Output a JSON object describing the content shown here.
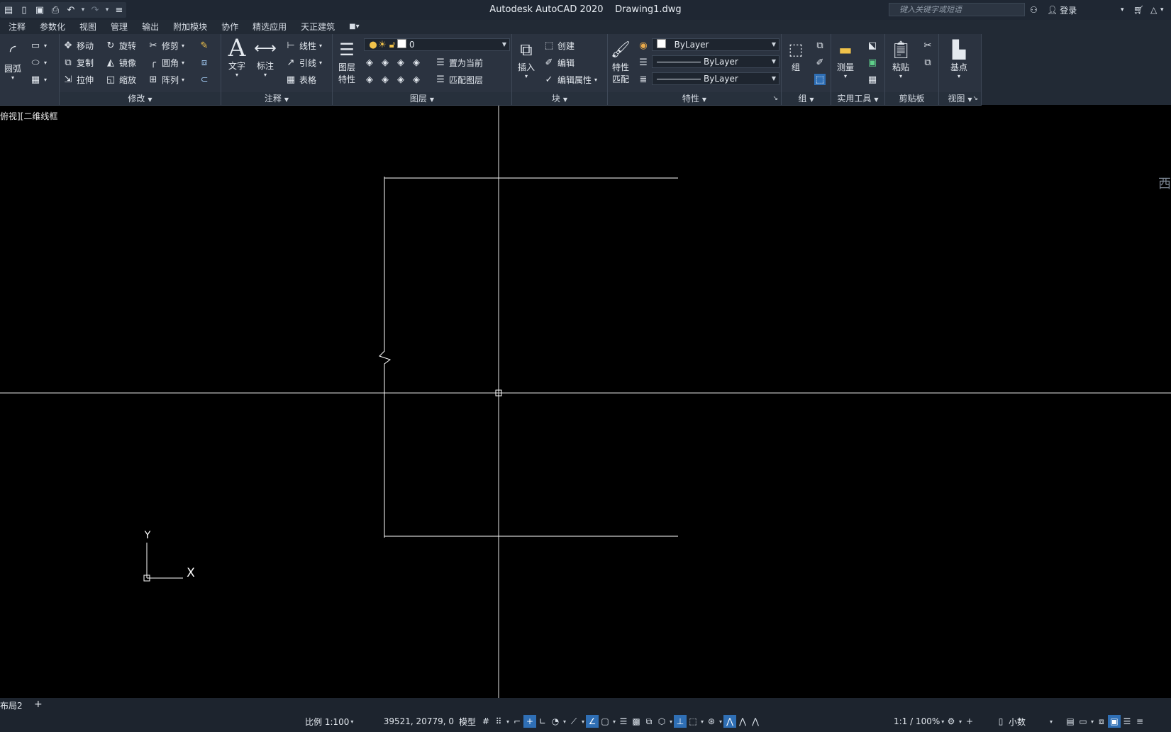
{
  "titlebar": {
    "app_title": "Autodesk AutoCAD 2020",
    "file_name": "Drawing1.dwg",
    "search_placeholder": "键入关键字或短语",
    "signin_label": "登录"
  },
  "menu": [
    "注释",
    "参数化",
    "视图",
    "管理",
    "输出",
    "附加模块",
    "协作",
    "精选应用",
    "天正建筑"
  ],
  "ribbon": {
    "draw": {
      "arc_label": "圆弧"
    },
    "modify": {
      "panel_label": "修改",
      "move": "移动",
      "rotate": "旋转",
      "trim": "修剪",
      "copy": "复制",
      "mirror": "镜像",
      "fillet": "圆角",
      "stretch": "拉伸",
      "scale": "缩放",
      "array": "阵列"
    },
    "annotation": {
      "panel_label": "注释",
      "text": "文字",
      "dimension": "标注",
      "linear": "线性",
      "leader": "引线",
      "table": "表格"
    },
    "layers": {
      "panel_label": "图层",
      "layer_props_1": "图层",
      "layer_props_2": "特性",
      "current_layer": "0",
      "set_current": "置为当前",
      "match_layer": "匹配图层"
    },
    "block": {
      "panel_label": "块",
      "insert": "插入",
      "create": "创建",
      "edit": "编辑",
      "edit_attr": "编辑属性"
    },
    "properties": {
      "panel_label": "特性",
      "match_1": "特性",
      "match_2": "匹配",
      "color": "ByLayer",
      "linetype": "ByLayer",
      "lineweight": "ByLayer"
    },
    "groups": {
      "panel_label": "组",
      "group": "组"
    },
    "utilities": {
      "panel_label": "实用工具",
      "measure": "测量"
    },
    "clipboard": {
      "panel_label": "剪贴板",
      "paste": "粘贴"
    },
    "view": {
      "panel_label": "视图",
      "base": "基点"
    }
  },
  "viewport": {
    "label": "俯视][二维线框",
    "ucs_x": "X",
    "ucs_y": "Y",
    "viewcube_hint": "西"
  },
  "layout": {
    "tab": "布局2",
    "add": "+"
  },
  "status": {
    "scale": "比例 1:100",
    "coords": "39521, 20779, 0",
    "model": "模型",
    "anno_scale": "1:1 / 100%",
    "units": "小数"
  },
  "colors": {
    "background": "#000000",
    "ribbon": "#2b3340",
    "titlebar": "#1f2733",
    "status_on": "#2f6fb5",
    "geometry": "#ffffff"
  }
}
